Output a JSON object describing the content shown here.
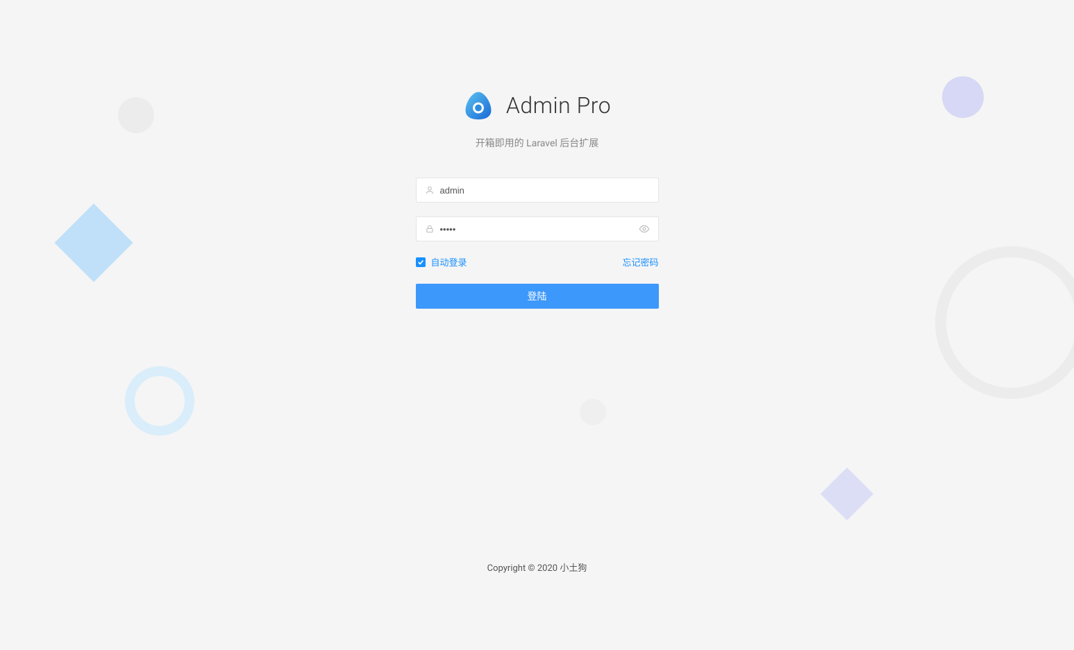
{
  "header": {
    "title": "Admin Pro",
    "subtitle": "开箱即用的 Laravel 后台扩展"
  },
  "form": {
    "username": {
      "value": "admin",
      "placeholder": ""
    },
    "password": {
      "value": "•••••",
      "placeholder": ""
    },
    "remember_label": "自动登录",
    "remember_checked": true,
    "forgot_label": "忘记密码",
    "submit_label": "登陆"
  },
  "footer": {
    "copyright": "Copyright © 2020 小土狗"
  },
  "icons": {
    "user": "user-icon",
    "lock": "lock-icon",
    "eye": "eye-icon",
    "logo": "logo-icon"
  }
}
